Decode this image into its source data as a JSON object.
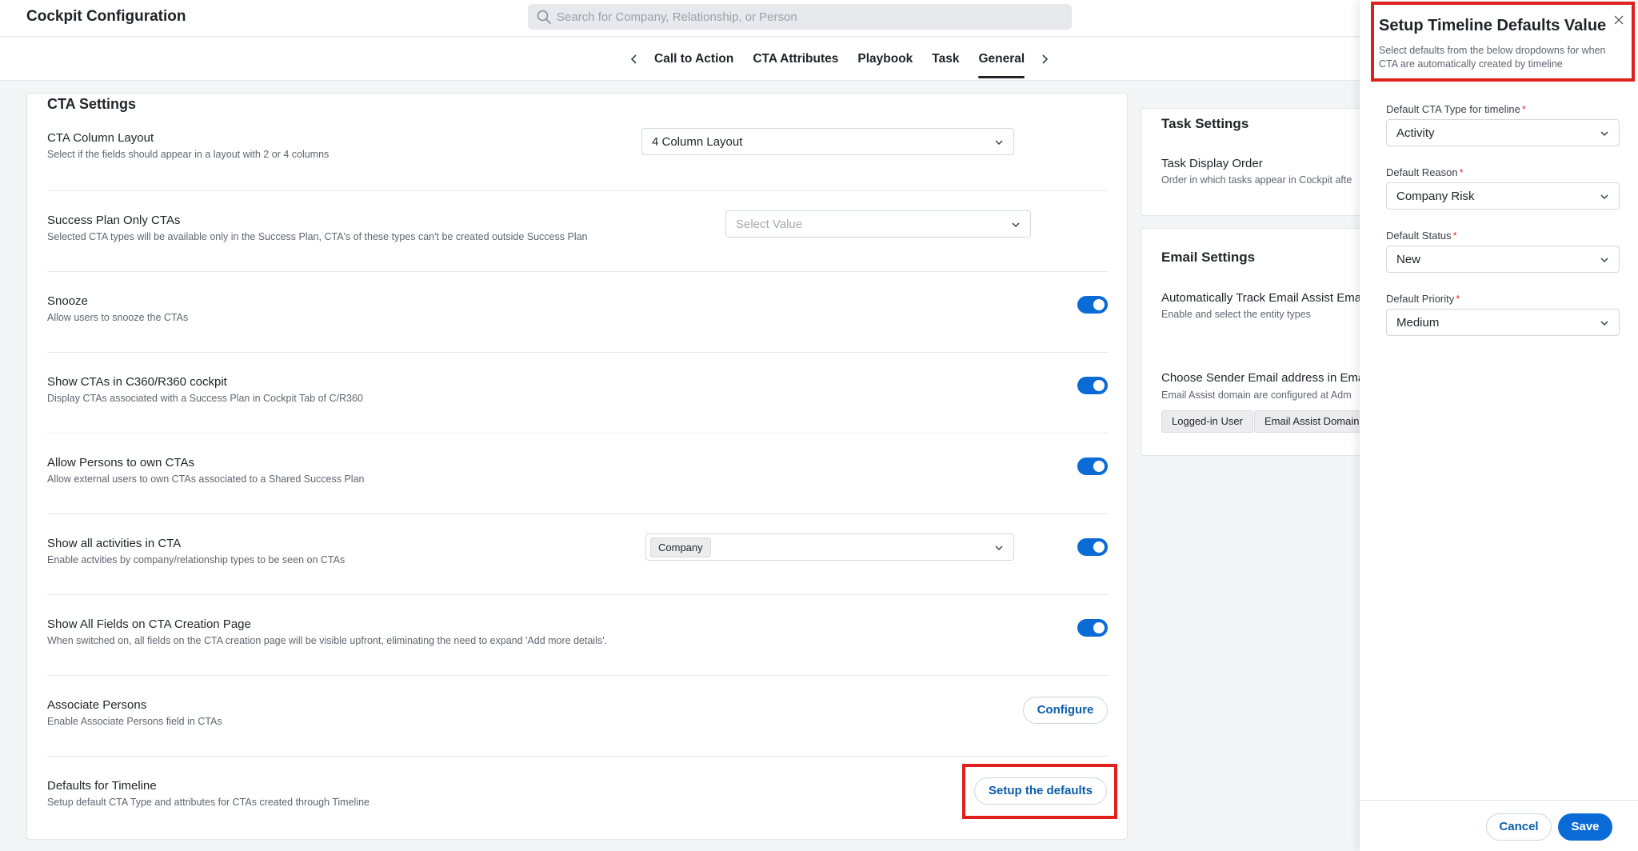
{
  "header": {
    "title": "Cockpit Configuration",
    "search_placeholder": "Search for Company, Relationship, or Person"
  },
  "tabs": [
    {
      "label": "Call to Action"
    },
    {
      "label": "CTA Attributes"
    },
    {
      "label": "Playbook"
    },
    {
      "label": "Task"
    },
    {
      "label": "General",
      "active": true
    }
  ],
  "cta_settings": {
    "title": "CTA Settings",
    "rows": [
      {
        "title": "CTA Column Layout",
        "desc": "Select if the fields should appear in a layout with 2 or 4 columns",
        "control": "select",
        "value": "4 Column Layout"
      },
      {
        "title": "Success Plan Only CTAs",
        "desc": "Selected CTA types will be available only in the Success Plan, CTA's of these types can't be created outside Success Plan",
        "control": "select",
        "placeholder": "Select Value"
      },
      {
        "title": "Snooze",
        "desc": "Allow users to snooze the CTAs",
        "control": "toggle",
        "on": true
      },
      {
        "title": "Show CTAs in C360/R360 cockpit",
        "desc": "Display CTAs associated with a Success Plan in Cockpit Tab of C/R360",
        "control": "toggle",
        "on": true
      },
      {
        "title": "Allow Persons to own CTAs",
        "desc": "Allow external users to own CTAs associated to a Shared Success Plan",
        "control": "toggle",
        "on": true
      },
      {
        "title": "Show all activities in CTA",
        "desc": "Enable actvities by company/relationship types to be seen on CTAs",
        "control": "multiselect+toggle",
        "chip": "Company",
        "on": true
      },
      {
        "title": "Show All Fields on CTA Creation Page",
        "desc": "When switched on, all fields on the CTA creation page will be visible upfront, eliminating the need to expand 'Add more details'.",
        "control": "toggle",
        "on": true
      },
      {
        "title": "Associate Persons",
        "desc": "Enable Associate Persons field in CTAs",
        "control": "button",
        "button": "Configure"
      },
      {
        "title": "Defaults for Timeline",
        "desc": "Setup default CTA Type and attributes for CTAs created through Timeline",
        "control": "button",
        "button": "Setup the defaults"
      }
    ]
  },
  "task_settings": {
    "title": "Task Settings",
    "row_title": "Task Display Order",
    "row_desc": "Order in which tasks appear in Cockpit afte"
  },
  "email_settings": {
    "title": "Email Settings",
    "row1_title": "Automatically Track Email Assist Ema",
    "row1_desc": "Enable and select the entity types",
    "row2_title": "Choose Sender Email address in Ema",
    "row2_desc": "Email Assist domain are configured at Adm",
    "tags": [
      "Logged-in User",
      "Email Assist Domain"
    ]
  },
  "panel": {
    "title": "Setup Timeline Defaults Value",
    "subtitle": "Select defaults from the below dropdowns for when CTA are automatically created by timeline",
    "fields": [
      {
        "label": "Default CTA Type for timeline",
        "value": "Activity"
      },
      {
        "label": "Default Reason",
        "value": "Company Risk"
      },
      {
        "label": "Default Status",
        "value": "New"
      },
      {
        "label": "Default Priority",
        "value": "Medium"
      }
    ],
    "required_mark": "*",
    "cancel_label": "Cancel",
    "save_label": "Save"
  },
  "colors": {
    "accent": "#0b6bd6",
    "link": "#0b5cad",
    "highlight": "#e0201b"
  },
  "icons": [
    "search-icon",
    "chevron-left-icon",
    "chevron-right-icon",
    "chevron-down-icon",
    "close-icon"
  ]
}
